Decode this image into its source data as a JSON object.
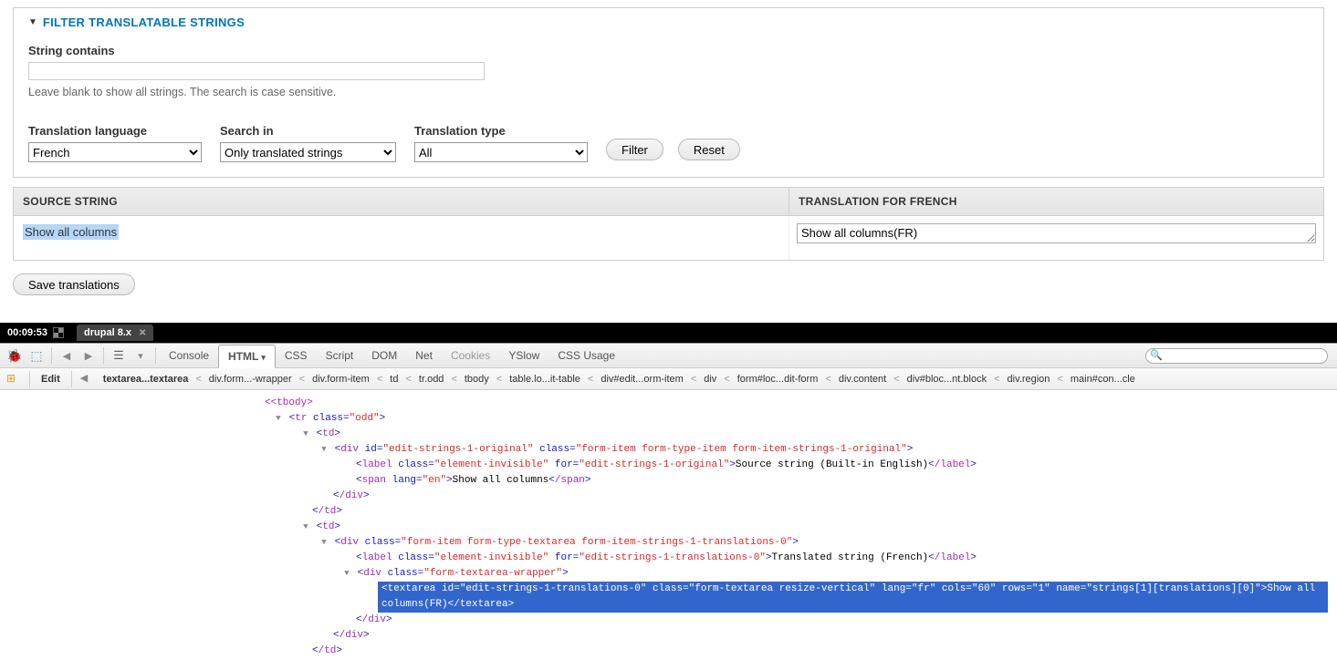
{
  "fieldset": {
    "legend": "FILTER TRANSLATABLE STRINGS",
    "string_contains_label": "String contains",
    "string_contains_value": "",
    "help": "Leave blank to show all strings. The search is case sensitive.",
    "lang_label": "Translation language",
    "lang_value": "French",
    "searchin_label": "Search in",
    "searchin_value": "Only translated strings",
    "type_label": "Translation type",
    "type_value": "All",
    "filter_btn": "Filter",
    "reset_btn": "Reset"
  },
  "table": {
    "h1": "SOURCE STRING",
    "h2": "TRANSLATION FOR FRENCH",
    "src": "Show all columns",
    "trans": "Show all columns(FR)"
  },
  "save_btn": "Save translations",
  "dev": {
    "timer": "00:09:53",
    "page_tab": "drupal 8.x",
    "tabs": {
      "console": "Console",
      "html": "HTML",
      "css": "CSS",
      "script": "Script",
      "dom": "DOM",
      "net": "Net",
      "cookies": "Cookies",
      "yslow": "YSlow",
      "cssusage": "CSS Usage"
    },
    "search_placeholder": ""
  },
  "bc": {
    "edit": "Edit",
    "items": [
      "textarea...textarea",
      "div.form...-wrapper",
      "div.form-item",
      "td",
      "tr.odd",
      "tbody",
      "table.lo...it-table",
      "div#edit...orm-item",
      "div",
      "form#loc...dit-form",
      "div.content",
      "div#bloc...nt.block",
      "div.region",
      "main#con...cle"
    ]
  },
  "code": {
    "l0": "<tbody>",
    "l1a": "tr",
    "l1b": "class=",
    "l1c": "\"odd\"",
    "l2": "td",
    "l3a": "div",
    "l3b": "id=",
    "l3c": "\"edit-strings-1-original\"",
    "l3d": "class=",
    "l3e": "\"form-item form-type-item form-item-strings-1-original\"",
    "l4a": "label",
    "l4b": "class=",
    "l4c": "\"element-invisible\"",
    "l4d": "for=",
    "l4e": "\"edit-strings-1-original\"",
    "l4f": "Source string (Built-in English)",
    "l4g": "/label",
    "l5a": "span",
    "l5b": "lang=",
    "l5c": "\"en\"",
    "l5d": "Show all columns",
    "l5e": "/span",
    "l6": "/div",
    "l7": "/td",
    "l8": "td",
    "l9a": "div",
    "l9b": "class=",
    "l9c": "\"form-item form-type-textarea form-item-strings-1-translations-0\"",
    "l10a": "label",
    "l10b": "class=",
    "l10c": "\"element-invisible\"",
    "l10d": "for=",
    "l10e": "\"edit-strings-1-translations-0\"",
    "l10f": "Translated string (French)",
    "l10g": "/label",
    "l11a": "div",
    "l11b": "class=",
    "l11c": "\"form-textarea-wrapper\"",
    "l12": "<textarea id=\"edit-strings-1-translations-0\" class=\"form-textarea resize-vertical\" lang=\"fr\" cols=\"60\" rows=\"1\" name=\"strings[1][translations][0]\">Show all columns(FR)</textarea>",
    "l13": "/div",
    "l14": "/div",
    "l15": "/td"
  }
}
